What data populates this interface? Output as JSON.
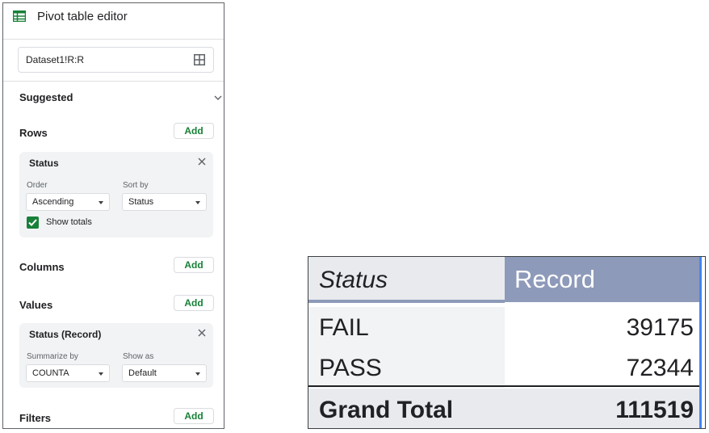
{
  "editor": {
    "title": "Pivot table editor",
    "range": "Dataset1!R:R",
    "suggested_label": "Suggested",
    "rows": {
      "label": "Rows",
      "add_label": "Add",
      "card": {
        "title": "Status",
        "order_label": "Order",
        "order_value": "Ascending",
        "sortby_label": "Sort by",
        "sortby_value": "Status",
        "show_totals_label": "Show totals",
        "show_totals_checked": true
      }
    },
    "columns": {
      "label": "Columns",
      "add_label": "Add"
    },
    "values": {
      "label": "Values",
      "add_label": "Add",
      "card": {
        "title": "Status (Record)",
        "summarize_label": "Summarize by",
        "summarize_value": "COUNTA",
        "showas_label": "Show as",
        "showas_value": "Default"
      }
    },
    "filters": {
      "label": "Filters",
      "add_label": "Add"
    }
  },
  "pivot": {
    "header_status": "Status",
    "header_record": "Record",
    "rows": [
      {
        "label": "FAIL",
        "value": "39175"
      },
      {
        "label": "PASS",
        "value": "72344"
      }
    ],
    "total_label": "Grand Total",
    "total_value": "111519"
  },
  "colors": {
    "accent_green": "#188038",
    "header_blue_grey": "#8e9ab9",
    "selection_blue": "#4285f4"
  }
}
